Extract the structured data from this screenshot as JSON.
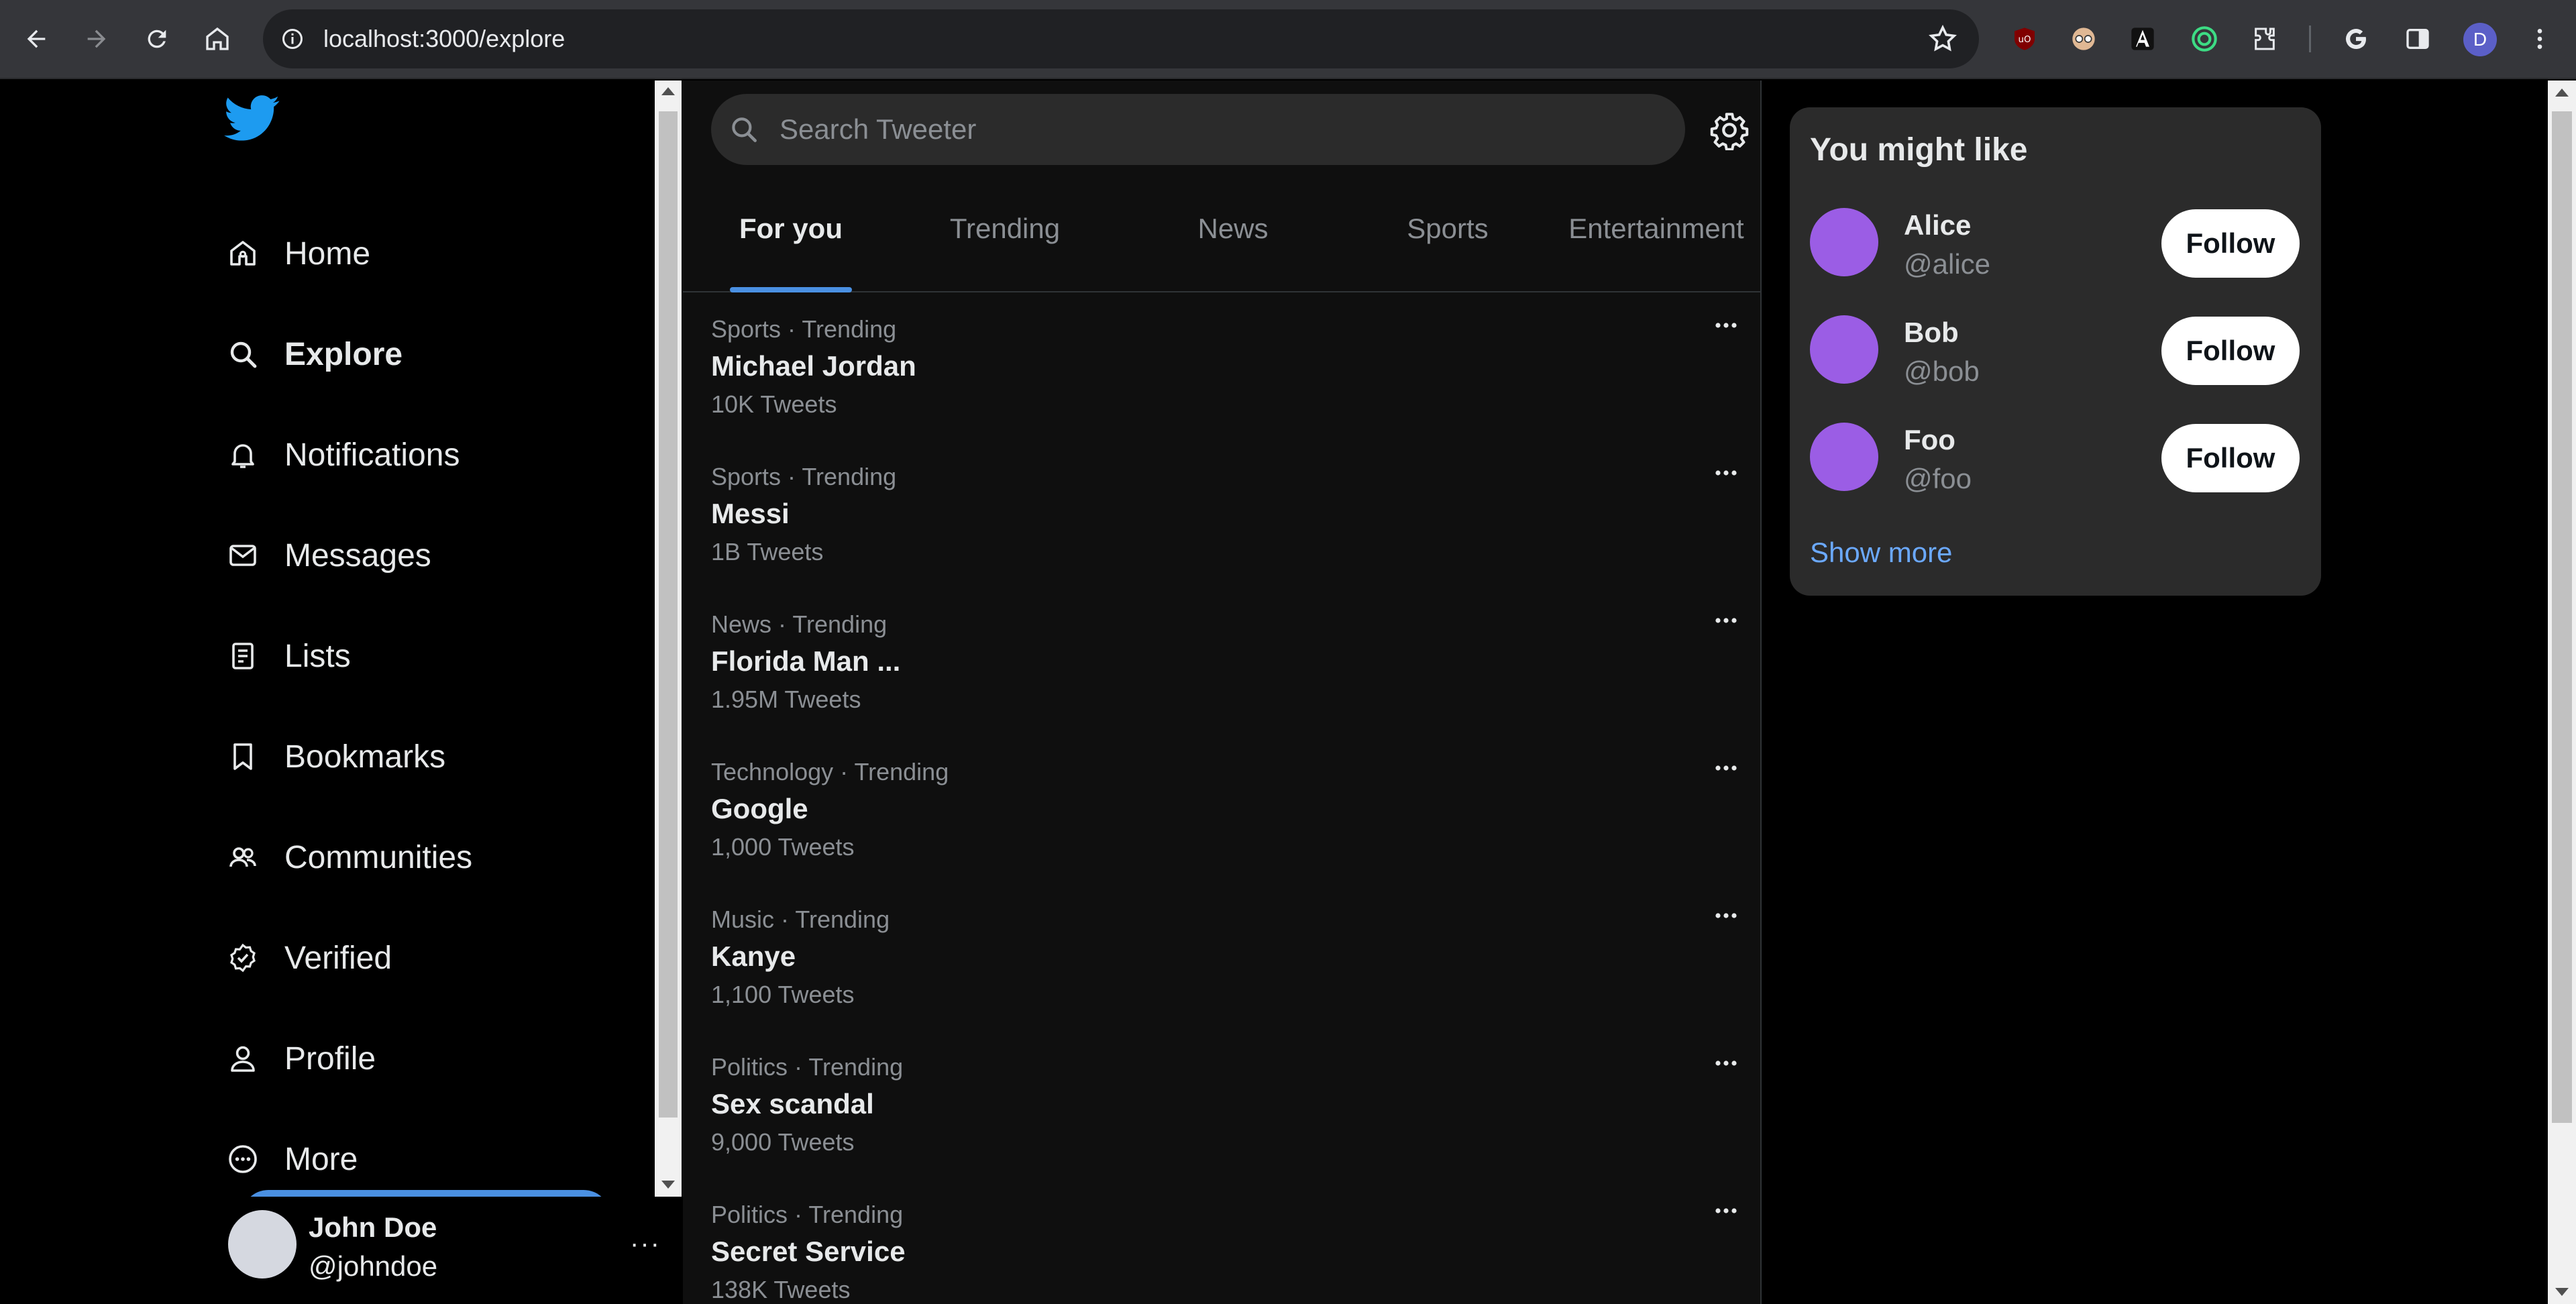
{
  "browser": {
    "url": "localhost:3000/explore",
    "profile_initial": "D",
    "icons": [
      "back-icon",
      "forward-icon",
      "reload-icon",
      "home-icon",
      "site-info-icon",
      "bookmark-star-icon",
      "ublock-icon",
      "incognito-extension-icon",
      "a-extension-icon",
      "target-extension-icon",
      "extensions-puzzle-icon",
      "google-icon",
      "side-panel-icon",
      "kebab-menu-icon"
    ]
  },
  "sidebar": {
    "items": [
      {
        "label": "Home",
        "icon": "home-icon"
      },
      {
        "label": "Explore",
        "icon": "search-icon",
        "active": true
      },
      {
        "label": "Notifications",
        "icon": "bell-icon"
      },
      {
        "label": "Messages",
        "icon": "mail-icon"
      },
      {
        "label": "Lists",
        "icon": "list-icon"
      },
      {
        "label": "Bookmarks",
        "icon": "bookmark-icon"
      },
      {
        "label": "Communities",
        "icon": "people-icon"
      },
      {
        "label": "Verified",
        "icon": "verified-icon"
      },
      {
        "label": "Profile",
        "icon": "user-icon"
      },
      {
        "label": "More",
        "icon": "more-circle-icon"
      }
    ],
    "user": {
      "name": "John Doe",
      "handle": "@johndoe",
      "more": "···"
    }
  },
  "main": {
    "search_placeholder": "Search Tweeter",
    "tabs": [
      {
        "label": "For you",
        "active": true
      },
      {
        "label": "Trending"
      },
      {
        "label": "News"
      },
      {
        "label": "Sports"
      },
      {
        "label": "Entertainment"
      }
    ],
    "trends": [
      {
        "meta": "Sports · Trending",
        "topic": "Michael Jordan",
        "count": "10K Tweets"
      },
      {
        "meta": "Sports · Trending",
        "topic": "Messi",
        "count": "1B Tweets"
      },
      {
        "meta": "News · Trending",
        "topic": "Florida Man ...",
        "count": "1.95M Tweets"
      },
      {
        "meta": "Technology · Trending",
        "topic": "Google",
        "count": "1,000 Tweets"
      },
      {
        "meta": "Music · Trending",
        "topic": "Kanye",
        "count": "1,100 Tweets"
      },
      {
        "meta": "Politics · Trending",
        "topic": "Sex scandal",
        "count": "9,000 Tweets"
      },
      {
        "meta": "Politics · Trending",
        "topic": "Secret Service",
        "count": "138K Tweets"
      }
    ]
  },
  "suggestions": {
    "title": "You might like",
    "people": [
      {
        "name": "Alice",
        "handle": "@alice",
        "button": "Follow"
      },
      {
        "name": "Bob",
        "handle": "@bob",
        "button": "Follow"
      },
      {
        "name": "Foo",
        "handle": "@foo",
        "button": "Follow"
      }
    ],
    "show_more": "Show more"
  },
  "colors": {
    "accent": "#4a90e2",
    "link": "#6ba9ff",
    "avatar_purple": "#9b5de5",
    "background": "#000000",
    "main_background": "#0f0f0f",
    "card": "#2b2b2b"
  }
}
